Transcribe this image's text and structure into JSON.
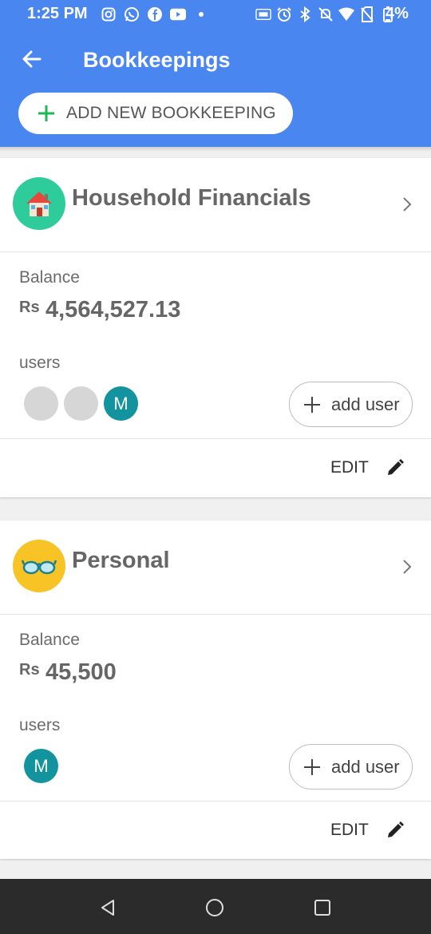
{
  "status_bar": {
    "time": "1:25 PM",
    "battery": "4%",
    "left_icons": [
      "instagram-icon",
      "whatsapp-icon",
      "facebook-icon",
      "youtube-icon",
      "dot-icon"
    ],
    "right_icons": [
      "lte-icon",
      "alarm-icon",
      "bluetooth-icon",
      "mute-icon",
      "wifi-icon",
      "no-sim-icon",
      "battery-icon"
    ]
  },
  "app_bar": {
    "title": "Bookkeepings",
    "add_button_label": "ADD NEW BOOKKEEPING"
  },
  "bookkeepings": [
    {
      "name": "Household Financials",
      "icon": "house-icon",
      "avatar_color": "#2ecc9a",
      "balance_label": "Balance",
      "currency": "Rs",
      "balance": "4,564,527.13",
      "users_label": "users",
      "users": [
        "",
        "",
        "M"
      ],
      "add_user_label": "add user",
      "edit_label": "EDIT"
    },
    {
      "name": "Personal",
      "icon": "glasses-icon",
      "avatar_color": "#f7c325",
      "balance_label": "Balance",
      "currency": "Rs",
      "balance": "45,500",
      "users_label": "users",
      "users": [
        "M"
      ],
      "add_user_label": "add user",
      "edit_label": "EDIT"
    }
  ],
  "nav_bar": {
    "buttons": [
      "back-icon",
      "home-icon",
      "recents-icon"
    ]
  },
  "colors": {
    "primary": "#4a86f0",
    "accent_green": "#1db954",
    "user_teal": "#13939e"
  }
}
